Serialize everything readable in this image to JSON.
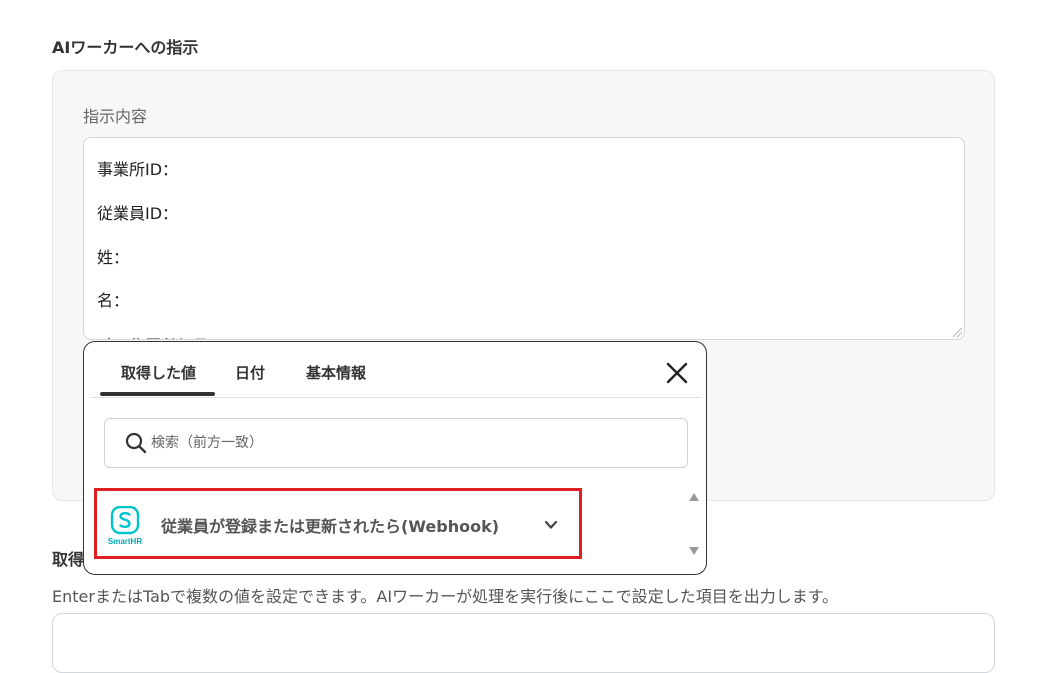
{
  "section": {
    "title": "AIワーカーへの指示"
  },
  "instructions": {
    "label": "指示内容",
    "lines": [
      "事業所ID：",
      "従業員ID：",
      "姓：",
      "名：",
      "メールアドレス："
    ]
  },
  "output": {
    "label_partial": "取得",
    "help_text": "EnterまたはTabで複数の値を設定できます。AIワーカーが処理を実行後にここで設定した項目を出力します。"
  },
  "popup": {
    "tabs": [
      {
        "label": "取得した値",
        "active": true
      },
      {
        "label": "日付",
        "active": false
      },
      {
        "label": "基本情報",
        "active": false
      }
    ],
    "search": {
      "placeholder": "検索（前方一致）"
    },
    "items": [
      {
        "app_name": "SmartHR",
        "title": "従業員が登録または更新されたら(Webhook)",
        "icon": "smarthr-logo"
      }
    ]
  },
  "colors": {
    "highlight": "#e02020",
    "smarthr_teal": "#00c4cc",
    "panel_bg": "#f6f7f8"
  }
}
